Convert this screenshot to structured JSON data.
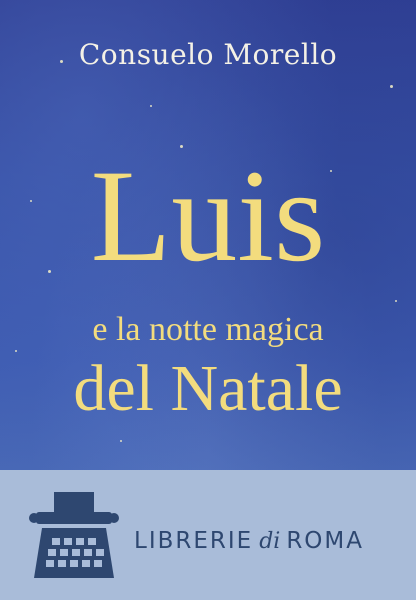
{
  "cover": {
    "author": "Consuelo Morello",
    "title_main": "Luis",
    "title_sub": "e la notte magica",
    "title_end": "del Natale"
  },
  "publisher": {
    "part1": "LIBRERIE",
    "part2": "di",
    "part3": "ROMA",
    "logo_icon": "typewriter-icon"
  },
  "colors": {
    "sky": "#3b58a8",
    "title": "#f3dc7e",
    "band": "#a9bcd9",
    "brand": "#2e4770"
  }
}
